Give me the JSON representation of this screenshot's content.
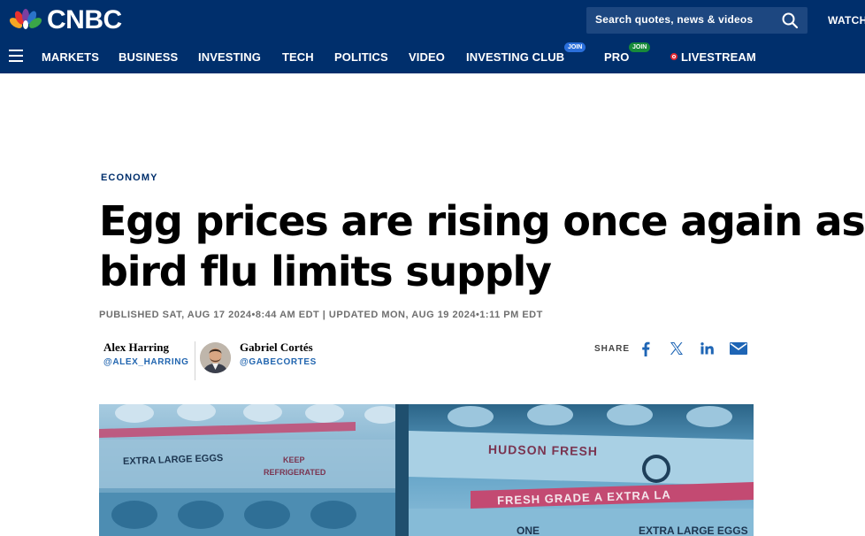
{
  "header": {
    "logo_text": "CNBC",
    "search_placeholder": "Search quotes, news & videos",
    "watch_label": "WATCH"
  },
  "nav": {
    "items": [
      {
        "label": "MARKETS"
      },
      {
        "label": "BUSINESS"
      },
      {
        "label": "INVESTING"
      },
      {
        "label": "TECH"
      },
      {
        "label": "POLITICS"
      },
      {
        "label": "VIDEO"
      },
      {
        "label": "INVESTING CLUB",
        "badge": "JOIN"
      },
      {
        "label": "PRO",
        "badge": "JOIN"
      },
      {
        "label": "LIVESTREAM"
      }
    ]
  },
  "article": {
    "section": "ECONOMY",
    "headline_line1": "Egg prices are rising once again as",
    "headline_line2": "bird flu limits supply",
    "timestamps": "PUBLISHED SAT, AUG 17 2024•8:44 AM EDT | UPDATED MON, AUG 19 2024•1:11 PM EDT",
    "authors": [
      {
        "name": "Alex Harring",
        "handle": "@ALEX_HARRING"
      },
      {
        "name": "Gabriel Cortés",
        "handle": "@GABECORTES"
      }
    ],
    "share_label": "SHARE",
    "share_icons": [
      "facebook-icon",
      "x-icon",
      "linkedin-icon",
      "email-icon"
    ]
  },
  "hero": {
    "carton_left_text_1": "EXTRA LARGE EGGS",
    "carton_left_text_2": "KEEP",
    "carton_left_text_3": "REFRIGERATED",
    "carton_right_brand": "HUDSON FRESH",
    "carton_right_band": "FRESH GRADE A EXTRA LA",
    "carton_right_bottom_1": "ONE",
    "carton_right_bottom_2": "EXTRA LARGE EGGS"
  },
  "colors": {
    "header_bg": "#002f6c",
    "accent_blue": "#1e65b5",
    "live_red": "#e3262f"
  }
}
